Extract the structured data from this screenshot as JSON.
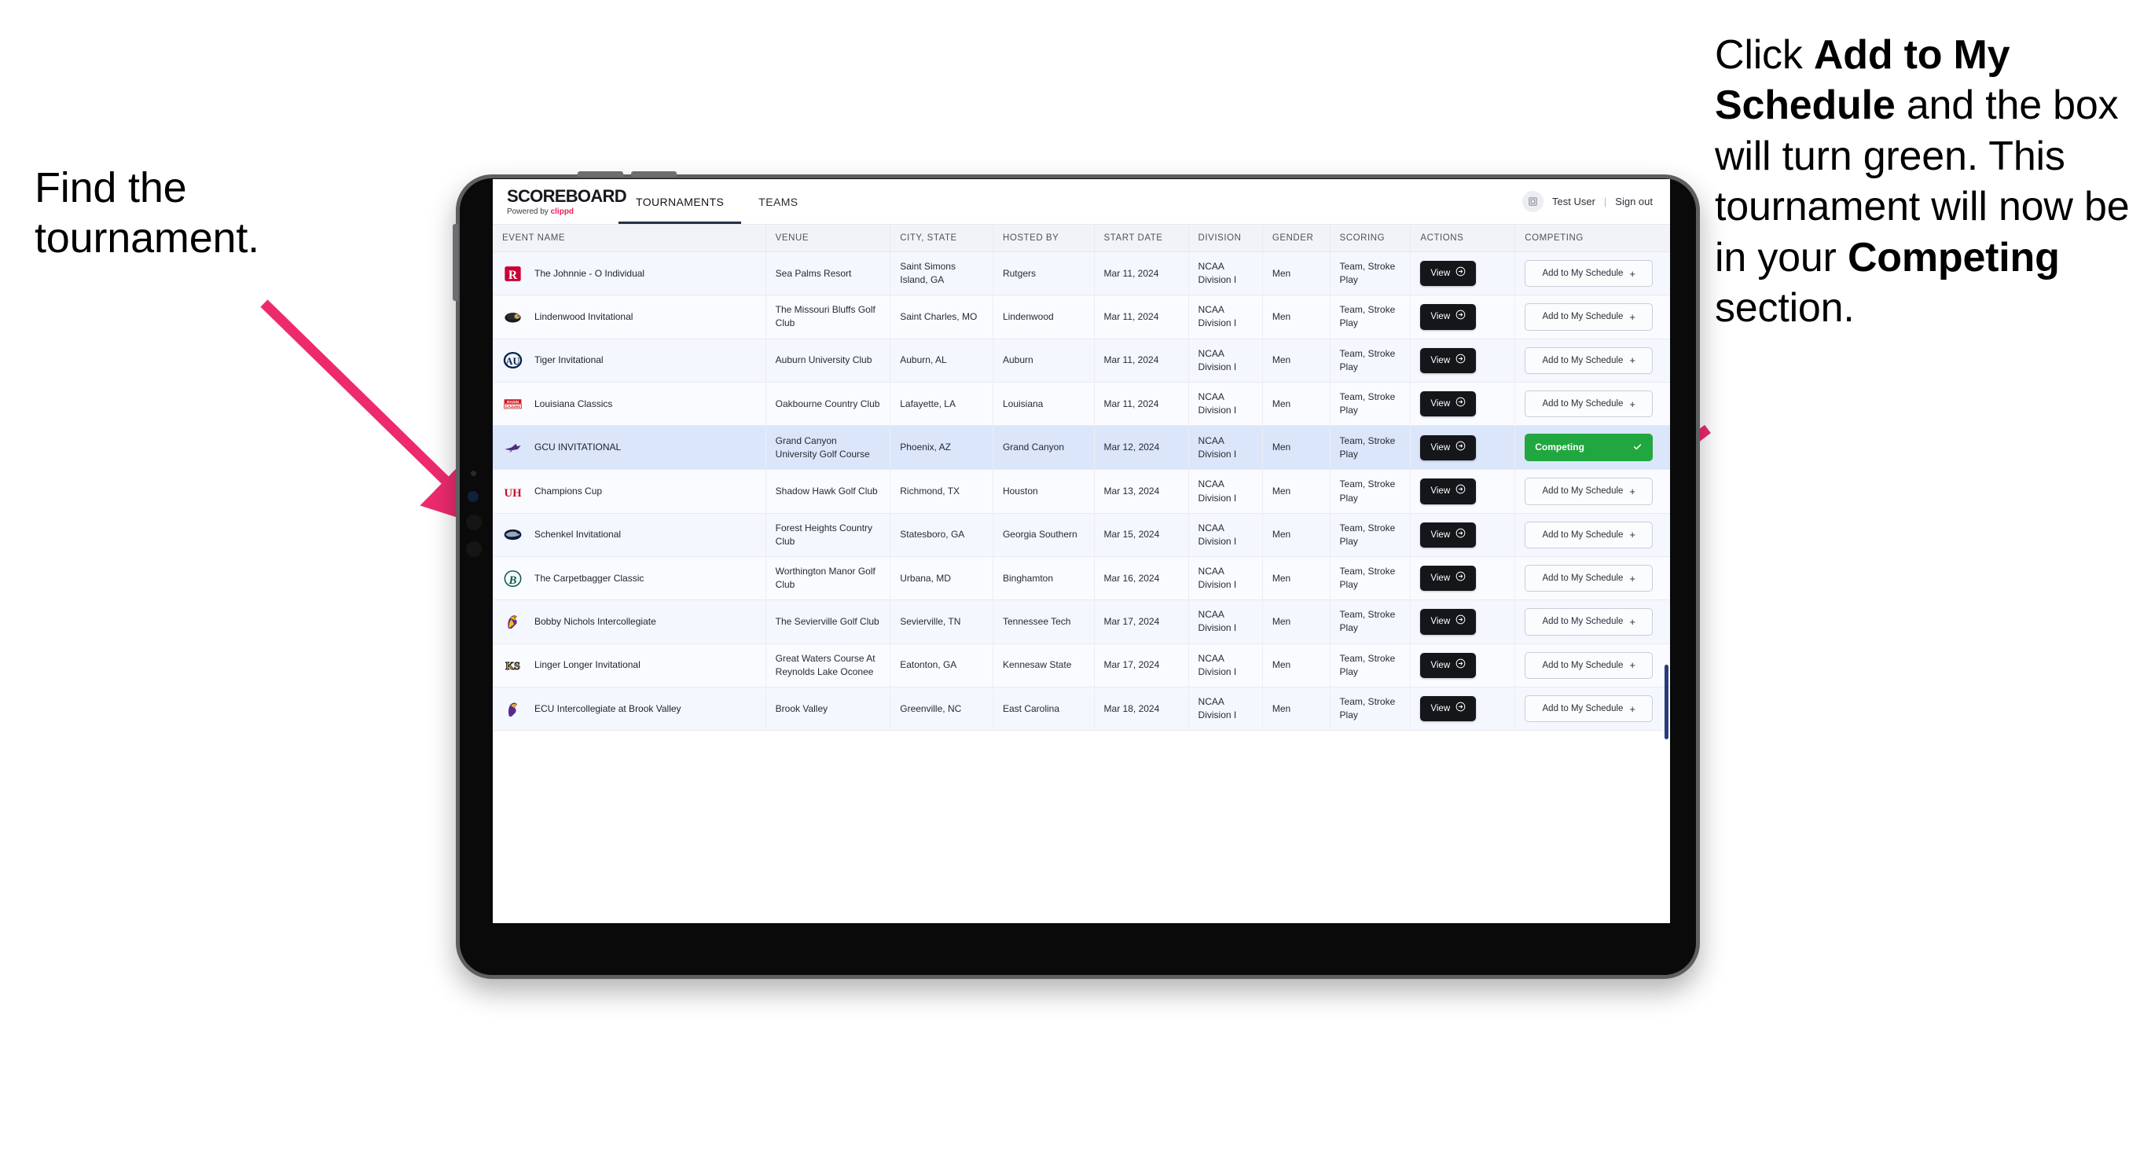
{
  "annotations": {
    "left": "Find the tournament.",
    "right_parts": [
      {
        "t": "Click ",
        "b": false
      },
      {
        "t": "Add to My Schedule",
        "b": true
      },
      {
        "t": " and the box will turn green. This tournament will now be in your ",
        "b": false
      },
      {
        "t": "Competing",
        "b": true
      },
      {
        "t": " section.",
        "b": false
      }
    ],
    "arrow_color": "#ed2a6e"
  },
  "app": {
    "brand_title": "SCOREBOARD",
    "brand_powered": "Powered by ",
    "brand_name": "clippd",
    "tabs": [
      {
        "label": "TOURNAMENTS",
        "active": true
      },
      {
        "label": "TEAMS",
        "active": false
      }
    ],
    "user": {
      "avatar_icon": "user-avatar-icon",
      "name": "Test User",
      "separator": "|",
      "signout": "Sign out"
    }
  },
  "table": {
    "columns": [
      "EVENT NAME",
      "VENUE",
      "CITY, STATE",
      "HOSTED BY",
      "START DATE",
      "DIVISION",
      "GENDER",
      "SCORING",
      "ACTIONS",
      "COMPETING"
    ],
    "view_label": "View",
    "add_label": "Add to My Schedule",
    "add_icon": "plus-icon",
    "competing_label": "Competing",
    "competing_icon": "check-icon",
    "view_icon": "arrow-right-circle-icon",
    "competing_color": "#20a73f",
    "rows": [
      {
        "logo": "rutgers-logo",
        "event": "The Johnnie - O Individual",
        "venue": "Sea Palms Resort",
        "city": "Saint Simons Island, GA",
        "host": "Rutgers",
        "date": "Mar 11, 2024",
        "division": "NCAA Division I",
        "gender": "Men",
        "scoring": "Team, Stroke Play",
        "competing": false
      },
      {
        "logo": "lindenwood-logo",
        "event": "Lindenwood Invitational",
        "venue": "The Missouri Bluffs Golf Club",
        "city": "Saint Charles, MO",
        "host": "Lindenwood",
        "date": "Mar 11, 2024",
        "division": "NCAA Division I",
        "gender": "Men",
        "scoring": "Team, Stroke Play",
        "competing": false
      },
      {
        "logo": "auburn-logo",
        "event": "Tiger Invitational",
        "venue": "Auburn University Club",
        "city": "Auburn, AL",
        "host": "Auburn",
        "date": "Mar 11, 2024",
        "division": "NCAA Division I",
        "gender": "Men",
        "scoring": "Team, Stroke Play",
        "competing": false
      },
      {
        "logo": "louisiana-logo",
        "event": "Louisiana Classics",
        "venue": "Oakbourne Country Club",
        "city": "Lafayette, LA",
        "host": "Louisiana",
        "date": "Mar 11, 2024",
        "division": "NCAA Division I",
        "gender": "Men",
        "scoring": "Team, Stroke Play",
        "competing": false
      },
      {
        "logo": "grand-canyon-logo",
        "event": "GCU INVITATIONAL",
        "venue": "Grand Canyon University Golf Course",
        "city": "Phoenix, AZ",
        "host": "Grand Canyon",
        "date": "Mar 12, 2024",
        "division": "NCAA Division I",
        "gender": "Men",
        "scoring": "Team, Stroke Play",
        "competing": true,
        "selected": true
      },
      {
        "logo": "houston-logo",
        "event": "Champions Cup",
        "venue": "Shadow Hawk Golf Club",
        "city": "Richmond, TX",
        "host": "Houston",
        "date": "Mar 13, 2024",
        "division": "NCAA Division I",
        "gender": "Men",
        "scoring": "Team, Stroke Play",
        "competing": false
      },
      {
        "logo": "georgia-southern-logo",
        "event": "Schenkel Invitational",
        "venue": "Forest Heights Country Club",
        "city": "Statesboro, GA",
        "host": "Georgia Southern",
        "date": "Mar 15, 2024",
        "division": "NCAA Division I",
        "gender": "Men",
        "scoring": "Team, Stroke Play",
        "competing": false
      },
      {
        "logo": "binghamton-logo",
        "event": "The Carpetbagger Classic",
        "venue": "Worthington Manor Golf Club",
        "city": "Urbana, MD",
        "host": "Binghamton",
        "date": "Mar 16, 2024",
        "division": "NCAA Division I",
        "gender": "Men",
        "scoring": "Team, Stroke Play",
        "competing": false
      },
      {
        "logo": "tennessee-tech-logo",
        "event": "Bobby Nichols Intercollegiate",
        "venue": "The Sevierville Golf Club",
        "city": "Sevierville, TN",
        "host": "Tennessee Tech",
        "date": "Mar 17, 2024",
        "division": "NCAA Division I",
        "gender": "Men",
        "scoring": "Team, Stroke Play",
        "competing": false
      },
      {
        "logo": "kennesaw-state-logo",
        "event": "Linger Longer Invitational",
        "venue": "Great Waters Course At Reynolds Lake Oconee",
        "city": "Eatonton, GA",
        "host": "Kennesaw State",
        "date": "Mar 17, 2024",
        "division": "NCAA Division I",
        "gender": "Men",
        "scoring": "Team, Stroke Play",
        "competing": false
      },
      {
        "logo": "east-carolina-logo",
        "event": "ECU Intercollegiate at Brook Valley",
        "venue": "Brook Valley",
        "city": "Greenville, NC",
        "host": "East Carolina",
        "date": "Mar 18, 2024",
        "division": "NCAA Division I",
        "gender": "Men",
        "scoring": "Team, Stroke Play",
        "competing": false,
        "cutoff": true
      }
    ]
  }
}
